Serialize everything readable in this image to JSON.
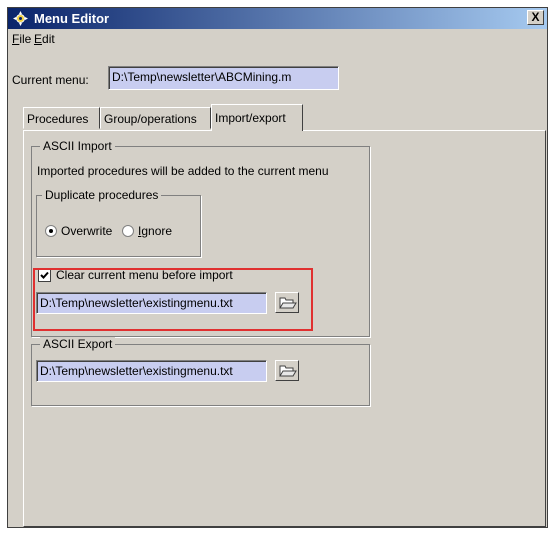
{
  "window": {
    "title": "Menu Editor",
    "close_symbol": "X"
  },
  "menubar": {
    "items": [
      {
        "accel": "F",
        "rest": "ile"
      },
      {
        "accel": "E",
        "rest": "dit"
      }
    ]
  },
  "current_menu": {
    "label": "Current menu:",
    "value": "D:\\Temp\\newsletter\\ABCMining.m"
  },
  "tabs": [
    {
      "label": "Procedures",
      "active": false
    },
    {
      "label": "Group/operations",
      "active": false
    },
    {
      "label": "Import/export",
      "active": true
    }
  ],
  "ascii_import": {
    "title": "ASCII Import",
    "description": "Imported procedures will be added to the current menu",
    "duplicate": {
      "title": "Duplicate procedures",
      "options": [
        {
          "label": "Overwrite",
          "selected": true
        },
        {
          "label": "Ignore",
          "accel": "I",
          "rest": "gnore",
          "selected": false
        }
      ]
    },
    "clear_checkbox": {
      "label": "Clear current menu before import",
      "checked": true
    },
    "file_path": "D:\\Temp\\newsletter\\existingmenu.txt"
  },
  "ascii_export": {
    "title": "ASCII Export",
    "file_path": "D:\\Temp\\newsletter\\existingmenu.txt"
  },
  "colors": {
    "field_bg": "#c8cdf0",
    "highlight": "#e03030",
    "titlebar_start": "#0a246a",
    "titlebar_end": "#a6caf0"
  },
  "icons": [
    "app-icon",
    "close-icon",
    "folder-open-icon"
  ]
}
